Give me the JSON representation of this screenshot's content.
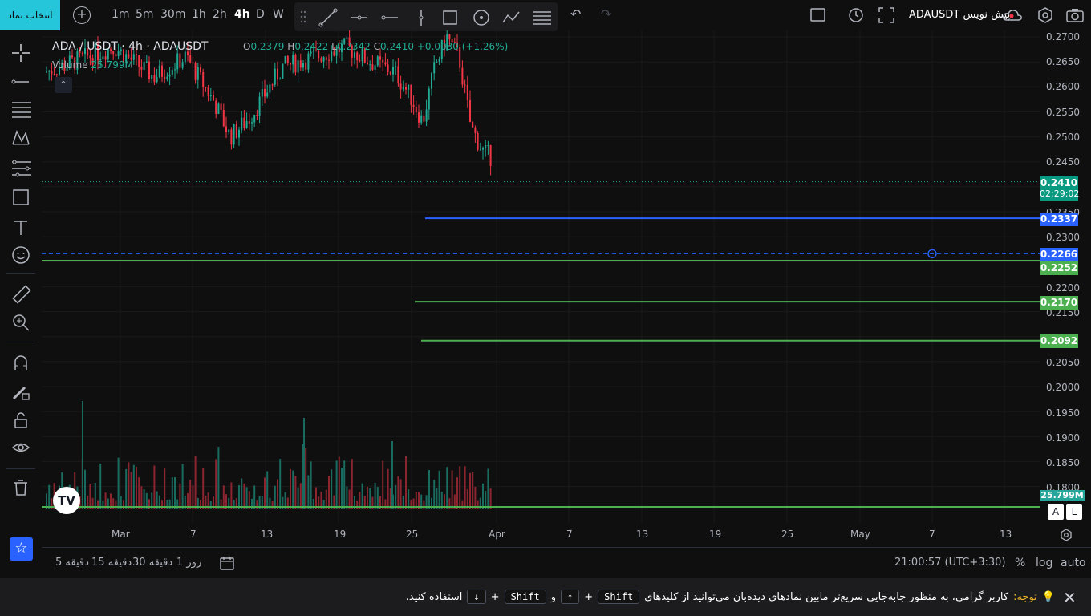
{
  "topbar": {
    "symbol_button": "انتخاب نماد",
    "timeframes": [
      "1m",
      "5m",
      "30m",
      "1h",
      "2h",
      "4h",
      "D",
      "W"
    ],
    "active_timeframe": "4h",
    "symbol_label": "ADAUSDT",
    "preview_label": "پیش نویس"
  },
  "legend": {
    "title": "ADA / USDT · 4h · ADAUSDT",
    "ohlc": {
      "o_label": "O",
      "o": "0.2379",
      "h_label": "H",
      "h": "0.2422",
      "l_label": "L",
      "l": "0.2342",
      "c_label": "C",
      "c": "0.2410",
      "change": "+0.0030 (+1.26%)"
    },
    "volume_label": "Volume",
    "volume_value": "25.799M"
  },
  "price_axis": {
    "ticks": [
      "0.2700",
      "0.2650",
      "0.2600",
      "0.2550",
      "0.2500",
      "0.2450",
      "0.2350",
      "0.2300",
      "0.2200",
      "0.2150",
      "0.2050",
      "0.2000",
      "0.1950",
      "0.1900",
      "0.1850",
      "0.1800"
    ],
    "current_price": "0.2410",
    "countdown": "02:29:02",
    "line_blue": "0.2337",
    "alert_line": "0.2266",
    "green_lines": [
      "0.2252",
      "0.2170",
      "0.2092"
    ],
    "volume_label": "25.799M"
  },
  "time_axis": {
    "ticks": [
      "Mar",
      "7",
      "13",
      "19",
      "25",
      "Apr",
      "7",
      "13",
      "19",
      "25",
      "May",
      "7",
      "13"
    ]
  },
  "axis_buttons": {
    "auto_scale": "A",
    "log_scale": "L"
  },
  "bottombar": {
    "ranges": [
      "5 دقیقه",
      "15 دقیقه",
      "30 دقیقه",
      "1 روز"
    ],
    "clock": "21:00:57 (UTC+3:30)",
    "percent": "%",
    "log": "log",
    "auto": "auto"
  },
  "notice": {
    "label": "توجه:",
    "text": "کاربر گرامی، به منظور جابه‌جایی سریع‌تر مابین نمادهای دیده‌بان می‌توانید از کلیدهای",
    "key1": "Shift",
    "key2": "↑",
    "and": "و",
    "key3": "Shift",
    "key4": "↓",
    "plus": "+",
    "suffix": "استفاده کنید."
  },
  "colors": {
    "accent": "#26c6da",
    "up": "#22ab94",
    "down": "#f23645",
    "blue_line": "#2962ff",
    "green_line": "#4caf50",
    "background": "#0f0f0f"
  },
  "icons": {
    "left_tools": [
      "crosshair-icon",
      "trendline-icon",
      "fib-icon",
      "pattern-icon",
      "prediction-icon",
      "shapes-icon",
      "text-icon",
      "emoji-icon",
      "ruler-icon",
      "zoom-icon",
      "magnet-icon",
      "lock-draw-icon",
      "lock-icon",
      "eye-icon",
      "trash-icon"
    ]
  }
}
